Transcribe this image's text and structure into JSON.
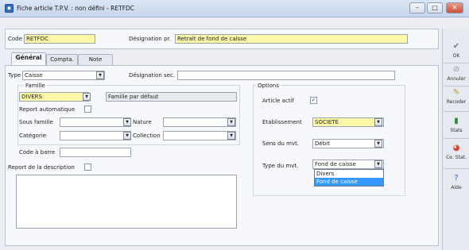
{
  "window": {
    "title": "Fiche article T.P.V. : non défini - RETFDC",
    "icon": "app-icon",
    "buttons": [
      "minimize",
      "maximize",
      "close"
    ],
    "button_glyphs": {
      "minimize": "–",
      "maximize": "□",
      "close": "✕"
    }
  },
  "header": {
    "code_label": "Code",
    "code_value": "RETFDC",
    "designation_label": "Désignation pr.",
    "designation_value": "Retrait de fond de caisse"
  },
  "tabs": [
    {
      "label": "Général",
      "active": true
    },
    {
      "label": "Compta.",
      "active": false
    },
    {
      "label": "Note",
      "active": false
    }
  ],
  "general": {
    "type_label": "Type",
    "type_value": "Caisse",
    "designation_sec_label": "Désignation sec.",
    "designation_sec_value": "",
    "famille_group_label": "Famille",
    "famille_value": "DIVERS",
    "famille_desc": "Famille par défaut",
    "report_auto_label": "Report automatique",
    "report_auto_checked": false,
    "sous_famille_label": "Sous famille",
    "sous_famille_value": "",
    "nature_label": "Nature",
    "nature_value": "",
    "categorie_label": "Catégorie",
    "categorie_value": "",
    "collection_label": "Collection",
    "collection_value": "",
    "code_barre_label": "Code à barre",
    "code_barre_value": "",
    "report_desc_label": "Report de la description",
    "report_desc_checked": false,
    "report_desc_text": ""
  },
  "options": {
    "group_label": "Options",
    "article_actif_label": "Article actif",
    "article_actif_checked": true,
    "check_glyph": "✓",
    "etablissement_label": "Etablissement",
    "etablissement_value": "SOCIETE",
    "sens_label": "Sens du mvt.",
    "sens_value": "Débit",
    "type_mvt_label": "Type du mvt.",
    "type_mvt_value": "Fond de caisse",
    "type_mvt_options": [
      {
        "label": "Divers",
        "selected": false
      },
      {
        "label": "Fond de caisse",
        "selected": true
      }
    ]
  },
  "toolbar": [
    {
      "label": "OK",
      "icon": "checkmark-icon",
      "glyph": "✔",
      "color": "#6c7a8c"
    },
    {
      "label": "Annuler",
      "icon": "cancel-icon",
      "glyph": "⊘",
      "color": "#8d96a3"
    },
    {
      "label": "Recoder",
      "icon": "recode-icon",
      "glyph": "✎",
      "color": "#c89a1c"
    },
    {
      "label": "Stats",
      "icon": "stats-icon",
      "glyph": "▮",
      "color": "#2f8a3a"
    },
    {
      "label": "Ce. Stat.",
      "icon": "pie-chart-icon",
      "glyph": "◕",
      "color": "#d4432c"
    },
    {
      "label": "Aide",
      "icon": "help-icon",
      "glyph": "?",
      "color": "#2a63b8"
    }
  ],
  "dropdown_glyph": "▼"
}
